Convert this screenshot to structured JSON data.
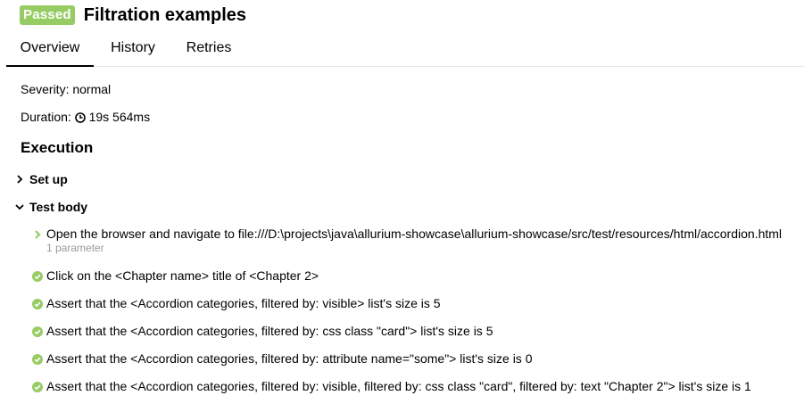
{
  "header": {
    "status": "Passed",
    "title": "Filtration examples"
  },
  "tabs": [
    {
      "label": "Overview"
    },
    {
      "label": "History"
    },
    {
      "label": "Retries"
    }
  ],
  "severity": {
    "label": "Severity:",
    "value": "normal"
  },
  "duration": {
    "label": "Duration:",
    "value": "19s 564ms"
  },
  "execution": {
    "title": "Execution",
    "setup_label": "Set up",
    "body_label": "Test body",
    "steps": [
      {
        "text": "Open the browser and navigate to file:///D:\\projects\\java\\allurium-showcase\\allurium-showcase/src/test/resources/html/accordion.html",
        "params": "1 parameter"
      },
      {
        "text": "Click on the <Chapter name> title of <Chapter 2>"
      },
      {
        "text": "Assert that the <Accordion categories, filtered by: visible> list's size is 5"
      },
      {
        "text": "Assert that the <Accordion categories, filtered by: css class \"card\"> list's size is 5"
      },
      {
        "text": "Assert that the <Accordion categories, filtered by: attribute name=\"some\"> list's size is 0"
      },
      {
        "text": "Assert that the <Accordion categories, filtered by: visible, filtered by: css class \"card\", filtered by: text \"Chapter 2\"> list's size is 1"
      }
    ]
  },
  "colors": {
    "passed": "#97cc64",
    "tab_border": "#e4e4e4",
    "muted": "#999999"
  }
}
